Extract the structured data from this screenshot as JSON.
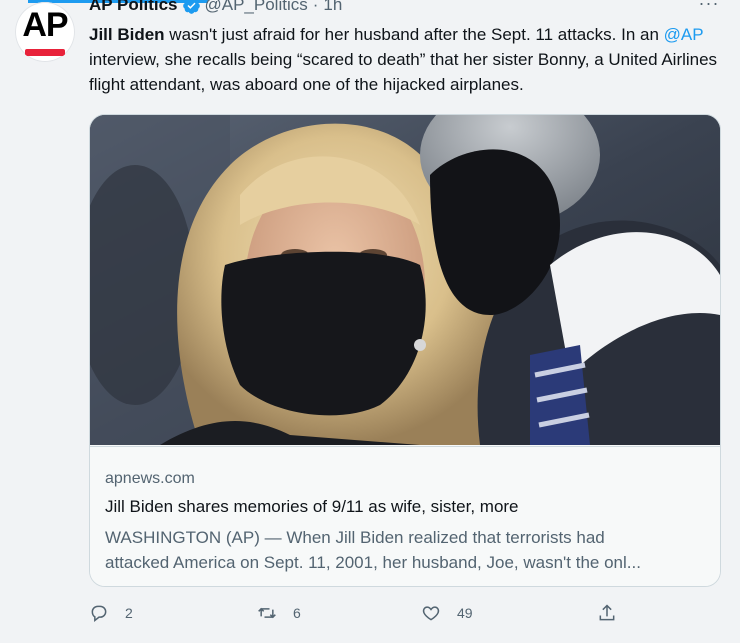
{
  "account": {
    "name": "AP Politics",
    "handle": "@AP_Politics",
    "time": "1h",
    "avatar_text": "AP"
  },
  "tweet": {
    "bold_name": "Jill Biden",
    "text_part1": " wasn't just afraid for her husband after the Sept. 11 attacks. In an ",
    "mention": "@AP",
    "text_part2": " interview, she recalls being “scared to death” that her sister Bonny, a United Airlines flight attendant, was aboard one of the hijacked airplanes."
  },
  "card": {
    "domain": "apnews.com",
    "title": "Jill Biden shares memories of 9/11 as wife, sister, more",
    "desc_line1": "WASHINGTON (AP) — When Jill Biden realized that terrorists had",
    "desc_line2": "attacked America on Sept. 11, 2001, her husband, Joe, wasn't the onl..."
  },
  "actions": {
    "reply_count": "2",
    "retweet_count": "6",
    "like_count": "49"
  },
  "colors": {
    "accent": "#1d9bf0",
    "ap_red": "#e8223a"
  },
  "icons": {
    "verified": "verified-badge-icon",
    "more": "more-icon",
    "reply": "reply-icon",
    "retweet": "retweet-icon",
    "like": "heart-icon",
    "share": "share-icon"
  }
}
